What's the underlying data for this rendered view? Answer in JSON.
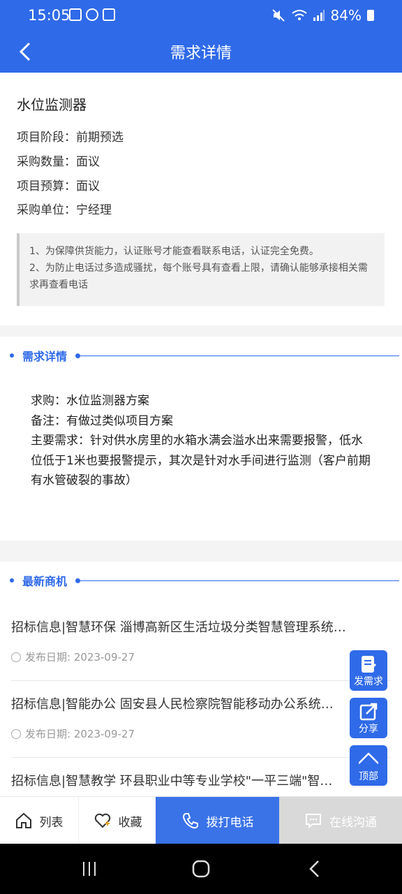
{
  "status_bar": {
    "time": "15:05",
    "battery": "84%"
  },
  "nav": {
    "title": "需求详情"
  },
  "product": {
    "title": "水位监测器",
    "rows": [
      "项目阶段：前期预选",
      "采购数量：面议",
      "项目预算：面议",
      "采购单位：宁经理"
    ]
  },
  "notice": {
    "line1": "1、为保障供货能力，认证账号才能查看联系电话，认证完全免费。",
    "line2": "2、为防止电话过多造成骚扰，每个账号具有查看上限，请确认能够承接相关需求再查看电话"
  },
  "detail_section": {
    "heading": "需求详情",
    "lines": [
      "求购：水位监测器方案",
      "备注：有做过类似项目方案",
      "主要需求：针对供水房里的水箱水满会溢水出来需要报警，低水位低于1米也要报警提示，其次是针对水手间进行监测（客户前期有水管破裂的事故）"
    ]
  },
  "latest_section": {
    "heading": "最新商机"
  },
  "latest_items": [
    {
      "title": "招标信息|智慧环保 淄博高新区生活垃圾分类智慧管理系统…",
      "date": "发布日期: 2023-09-27"
    },
    {
      "title": "招标信息|智能办公 固安县人民检察院智能移动办公系统…",
      "date": "发布日期: 2023-09-27"
    },
    {
      "title": "招标信息|智慧教学 环县职业中等专业学校\"一平三端\"智…",
      "date": ""
    }
  ],
  "fabs": {
    "post": "发需求",
    "share": "分享",
    "top": "顶部"
  },
  "bottom_bar": {
    "list": "列表",
    "favorite": "收藏",
    "call": "拨打电话",
    "chat": "在线沟通"
  },
  "colors": {
    "brand": "#2f6ae8",
    "disabled": "#d9d9d9"
  }
}
